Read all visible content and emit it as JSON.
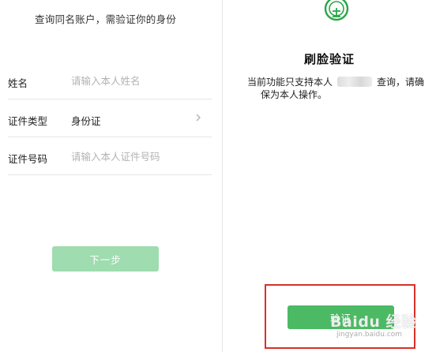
{
  "left_panel": {
    "subtitle": "查询同名账户，需验证你的身份",
    "fields": [
      {
        "label": "姓名",
        "placeholder": "请输入本人姓名",
        "value": ""
      },
      {
        "label": "证件类型",
        "value": "身份证"
      },
      {
        "label": "证件号码",
        "placeholder": "请输入本人证件号码",
        "value": ""
      }
    ],
    "next_button": "下一步"
  },
  "right_panel": {
    "logo_icon": "face-scan-logo-icon",
    "title": "刷脸验证",
    "desc_part1": "当前功能只支持本人",
    "desc_part2": "查询，请确",
    "desc_line2": "保为本人操作。",
    "verify_button": "验证"
  },
  "watermark": {
    "main": "Baidu 经验",
    "sub": "jingyan.baidu.com"
  },
  "colors": {
    "accent_green": "#4cba64",
    "disabled_green": "#9fdcaf",
    "highlight_red": "#d93025",
    "logo_green": "#2aa54a"
  }
}
